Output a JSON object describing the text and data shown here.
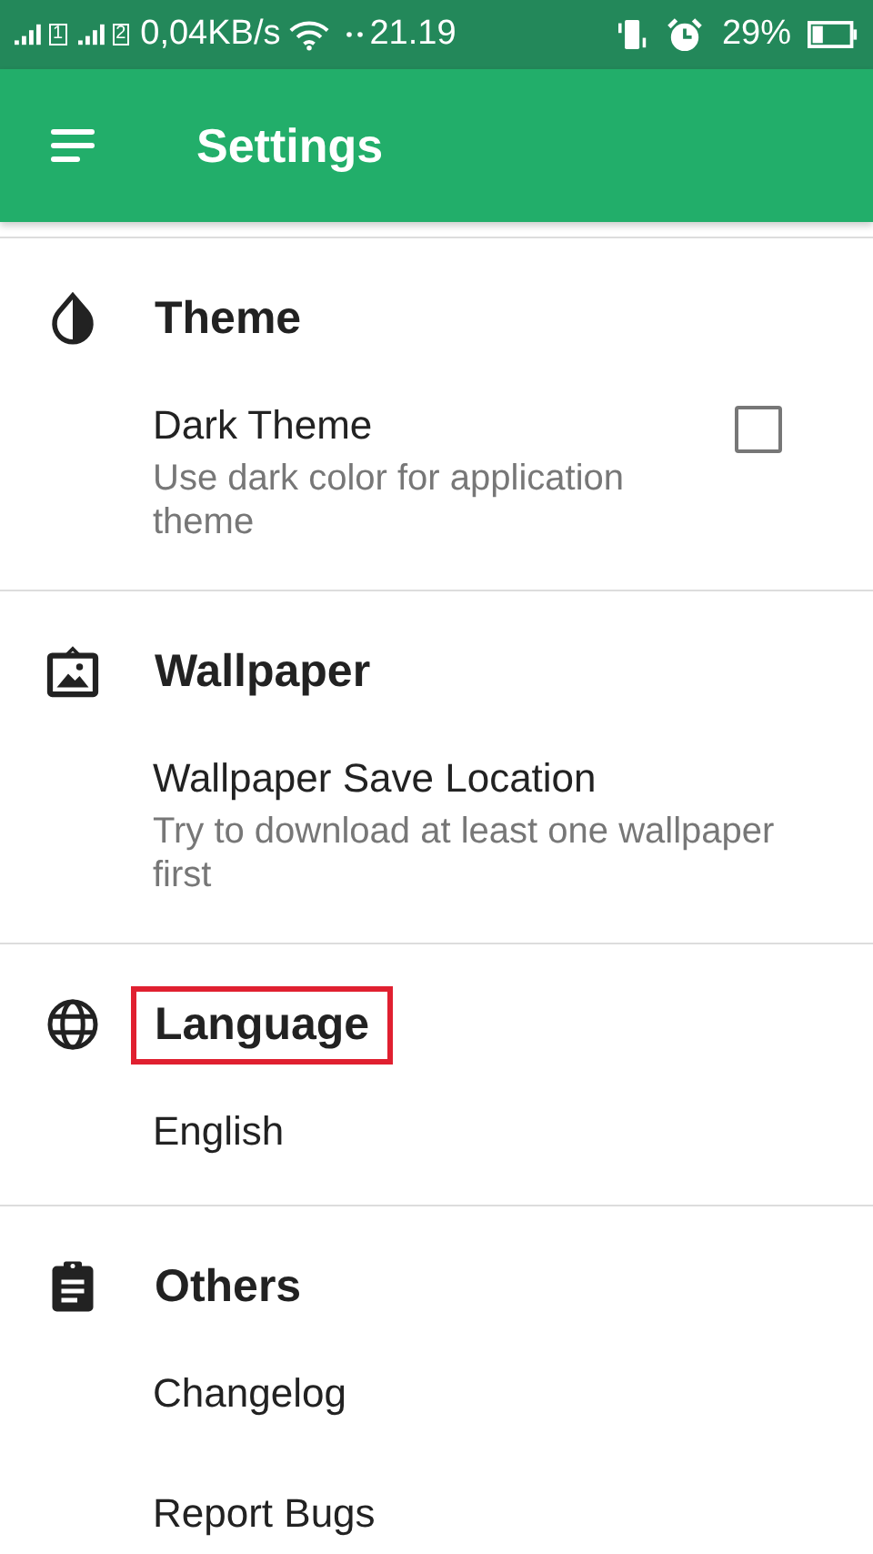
{
  "status_bar": {
    "sim_1": "1",
    "sim_2": "2",
    "speed": "0,04KB/s",
    "time": "21.19",
    "battery": "29%"
  },
  "app_bar": {
    "title": "Settings"
  },
  "sections": [
    {
      "title": "Theme",
      "kind": "theme",
      "highlighted": false,
      "items": [
        {
          "kind": "checkbox",
          "title": "Dark Theme",
          "summary": "Use dark color for application theme",
          "checked": false
        }
      ]
    },
    {
      "title": "Wallpaper",
      "kind": "wallpaper",
      "highlighted": false,
      "items": [
        {
          "kind": "text",
          "title": "Wallpaper Save Location",
          "summary": "Try to download at least one wallpaper first"
        }
      ]
    },
    {
      "title": "Language",
      "kind": "language",
      "highlighted": true,
      "items": [
        {
          "kind": "text",
          "title": "English"
        }
      ]
    },
    {
      "title": "Others",
      "kind": "others",
      "highlighted": false,
      "items": [
        {
          "kind": "text",
          "title": "Changelog"
        },
        {
          "kind": "text",
          "title": "Report Bugs"
        }
      ]
    }
  ]
}
